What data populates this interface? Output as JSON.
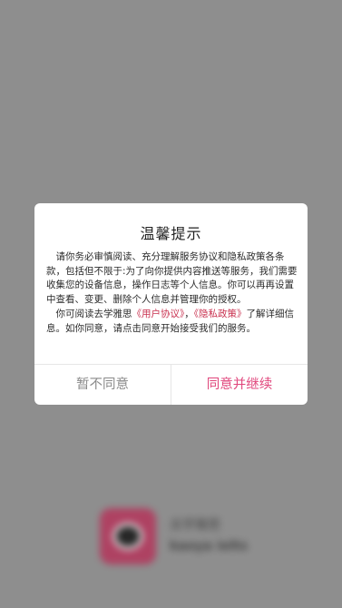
{
  "splash": {
    "brand_name": "去学雅思",
    "brand_sub": "kaoya ielts"
  },
  "dialog": {
    "title": "温馨提示",
    "paragraph1": "请你务必审慎阅读、充分理解服务协议和隐私政策各条款，包括但不限于:为了向你提供内容推送等服务，我们需要收集您的设备信息，操作日志等个人信息。你可以再再设置中查看、变更、删除个人信息并管理你的授权。",
    "paragraph2_before": "你可阅读去学雅思",
    "user_agreement_link": "《用户协议》",
    "link_separator": "，",
    "privacy_policy_link": "《隐私政策》",
    "paragraph2_after": "了解详细信息。如你同意，请点击同意开始接受我们的服务。",
    "disagree_button": "暂不同意",
    "agree_button": "同意并继续"
  },
  "colors": {
    "overlay": "#8e8e8e",
    "link": "#c9314f",
    "agree_button": "#e0467c",
    "disagree_button": "#8a8a8a"
  }
}
